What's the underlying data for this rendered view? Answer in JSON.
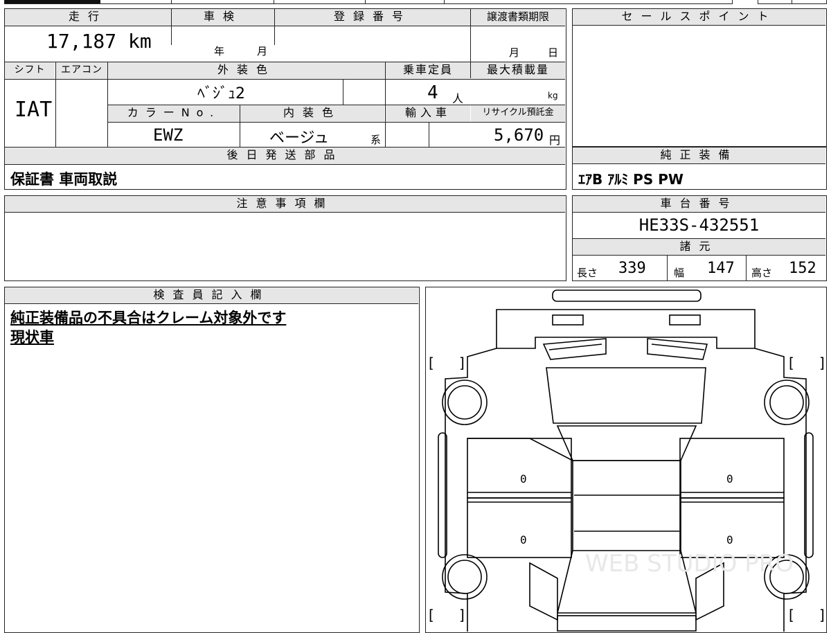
{
  "top_strip": {
    "note": ""
  },
  "main": {
    "mileage_label": "走行",
    "mileage_value": "17,187 km",
    "inspection_label": "車検",
    "inspection_year": "年",
    "inspection_month": "月",
    "registration_label": "登録番号",
    "registration_value": "",
    "transfer_deadline_label": "譲渡書類期限",
    "transfer_month": "月",
    "transfer_day": "日",
    "shift_label": "シフト",
    "shift_value": "IAT",
    "aircon_label": "エアコン",
    "aircon_value": "",
    "exterior_color_label": "外装色",
    "exterior_color_value": "ﾍﾞｼﾞｭ2",
    "seating_label": "乗車定員",
    "seating_value": "4",
    "seating_unit": "人",
    "max_load_label": "最大積載量",
    "max_load_unit": "kg",
    "color_no_label": "カラーNo.",
    "color_no_value": "EWZ",
    "interior_color_label": "内装色",
    "interior_color_value": "ベージュ",
    "interior_color_suffix": "系",
    "import_label": "輸入車",
    "recycle_label": "リサイクル預託金",
    "recycle_value": "5,670",
    "recycle_unit": "円",
    "later_parts_label": "後日発送部品",
    "later_parts_value": "保証書 車両取説"
  },
  "sales_point": {
    "label": "セールスポイント",
    "value": ""
  },
  "equipment": {
    "label": "純正装備",
    "value": "ｴｱB ｱﾙﾐ PS PW"
  },
  "notes": {
    "label": "注意事項欄",
    "value": ""
  },
  "chassis": {
    "label": "車台番号",
    "value": "HE33S-432551"
  },
  "specs": {
    "label": "諸元",
    "length_label": "長さ",
    "length_value": "339",
    "width_label": "幅",
    "width_value": "147",
    "height_label": "高さ",
    "height_value": "152"
  },
  "inspector": {
    "label": "検査員記入欄",
    "line1": "純正装備品の不具合はクレーム対象外です",
    "line2": "現状車"
  },
  "diagram": {
    "door_marks": [
      "0",
      "0",
      "0",
      "0"
    ],
    "bracket_left": "[",
    "bracket_right": "]",
    "watermark": "WEB STUDIO PRO"
  }
}
